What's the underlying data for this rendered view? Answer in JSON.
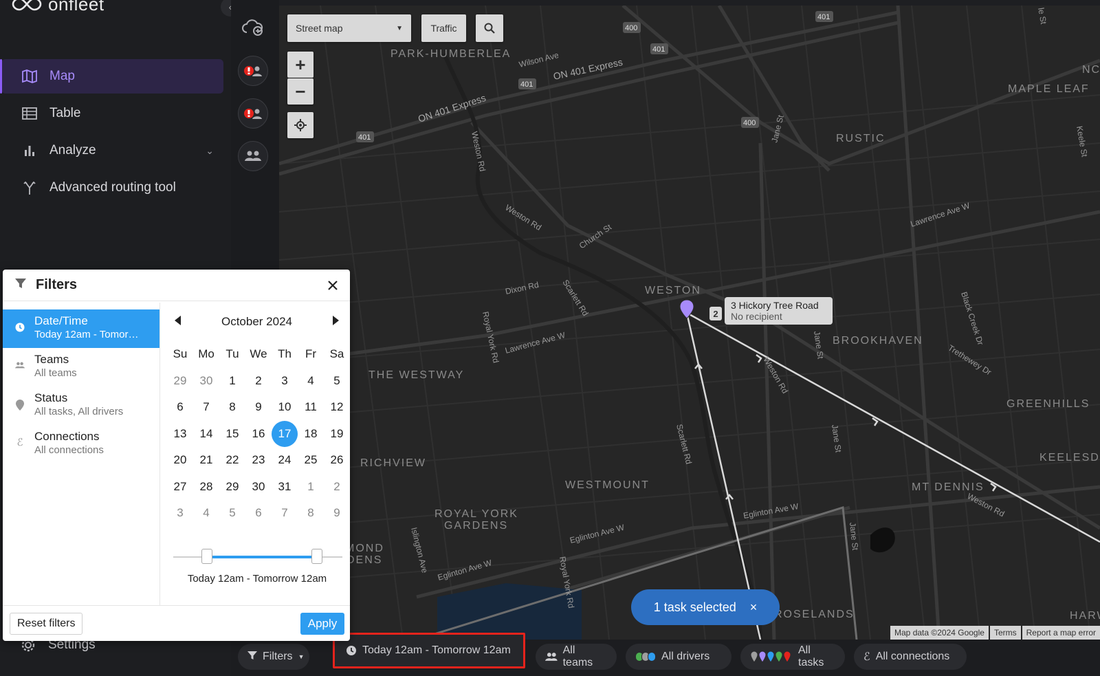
{
  "brand": {
    "logo_text": "onfleet"
  },
  "nav": {
    "items": [
      {
        "label": "Map",
        "icon": "map-icon",
        "active": true
      },
      {
        "label": "Table",
        "icon": "table-icon",
        "active": false
      },
      {
        "label": "Analyze",
        "icon": "bar-chart-icon",
        "active": false
      },
      {
        "label": "Advanced routing tool",
        "icon": "routing-icon",
        "active": false
      }
    ],
    "settings_label": "Settings"
  },
  "map": {
    "type_select": "Street map",
    "traffic_label": "Traffic",
    "zoom_in": "+",
    "zoom_out": "−",
    "pin": {
      "count": "2",
      "title": "3 Hickory Tree Road",
      "subtitle": "No recipient"
    },
    "task_pill": {
      "label": "1 task selected",
      "close": "×"
    },
    "attribution": [
      "Map data ©2024 Google",
      "Terms",
      "Report a map error"
    ],
    "labels": [
      {
        "text": "PARK-HUMBERLEA"
      },
      {
        "text": "RUSTIC"
      },
      {
        "text": "MAPLE LEAF"
      },
      {
        "text": "WESTON"
      },
      {
        "text": "BROOKHAVEN"
      },
      {
        "text": "THE WESTWAY"
      },
      {
        "text": "GREENHILLS"
      },
      {
        "text": "RICHVIEW"
      },
      {
        "text": "WESTMOUNT"
      },
      {
        "text": "KEELESDALE"
      },
      {
        "text": "MT DENNIS"
      },
      {
        "text": "ROYAL YORK"
      },
      {
        "text": "GARDENS"
      },
      {
        "text": "ROSELANDS"
      },
      {
        "text": "HARW"
      },
      {
        "text": "NC"
      },
      {
        "text": "MOND"
      },
      {
        "text": "DENS"
      }
    ],
    "roads": [
      "Wilson Ave",
      "ON 401 Express",
      "ON 401 Express",
      "Weston Rd",
      "Jane St",
      "Weston Rd",
      "Church St",
      "Lawrence Ave W",
      "Dixon Rd",
      "Scarlett Rd",
      "Royal York Rd",
      "Lawrence Ave W",
      "Jane St",
      "Weston Rd",
      "Black Creek Dr",
      "Trethewey Dr",
      "Scarlett Rd",
      "Jane St",
      "Weston Rd",
      "Eglinton Ave W",
      "Eglinton Ave W",
      "Eglinton Ave W",
      "Islington Ave",
      "Royal York Rd",
      "Jane St",
      "Keele St",
      "le St"
    ],
    "shields": [
      "400",
      "401",
      "401",
      "401",
      "401",
      "400"
    ]
  },
  "bottombar": {
    "filters_label": "Filters",
    "date_range": "Today 12am - Tomorrow 12am",
    "teams": "All teams",
    "drivers": "All drivers",
    "tasks": "All tasks",
    "connections": "All connections",
    "colors": {
      "highlight": "#e5231c",
      "drivers": [
        "#4caf50",
        "#9e9e9e",
        "#2e9df0"
      ],
      "tasks": [
        "#9e9e9e",
        "#a78bfa",
        "#2e9df0",
        "#4caf50",
        "#e5231c"
      ]
    }
  },
  "filters": {
    "title": "Filters",
    "close": "×",
    "categories": [
      {
        "title": "Date/Time",
        "value": "Today 12am - Tomor…",
        "icon": "clock-icon",
        "active": true
      },
      {
        "title": "Teams",
        "value": "All teams",
        "icon": "team-icon",
        "active": false
      },
      {
        "title": "Status",
        "value": "All tasks, All drivers",
        "icon": "pin-icon",
        "active": false
      },
      {
        "title": "Connections",
        "value": "All connections",
        "icon": "connection-icon",
        "active": false
      }
    ],
    "calendar": {
      "month_label": "October 2024",
      "weekdays": [
        "Su",
        "Mo",
        "Tu",
        "We",
        "Th",
        "Fr",
        "Sa"
      ],
      "weeks": [
        [
          "29",
          "30",
          "1",
          "2",
          "3",
          "4",
          "5"
        ],
        [
          "6",
          "7",
          "8",
          "9",
          "10",
          "11",
          "12"
        ],
        [
          "13",
          "14",
          "15",
          "16",
          "17",
          "18",
          "19"
        ],
        [
          "20",
          "21",
          "22",
          "23",
          "24",
          "25",
          "26"
        ],
        [
          "27",
          "28",
          "29",
          "30",
          "31",
          "1",
          "2"
        ],
        [
          "3",
          "4",
          "5",
          "6",
          "7",
          "8",
          "9"
        ]
      ],
      "selected": "17"
    },
    "time_range": {
      "label": "Today 12am - Tomorrow 12am",
      "start_fraction": 0.2,
      "end_fraction": 0.85
    },
    "reset_label": "Reset filters",
    "apply_label": "Apply",
    "accent": "#2e9df0"
  }
}
